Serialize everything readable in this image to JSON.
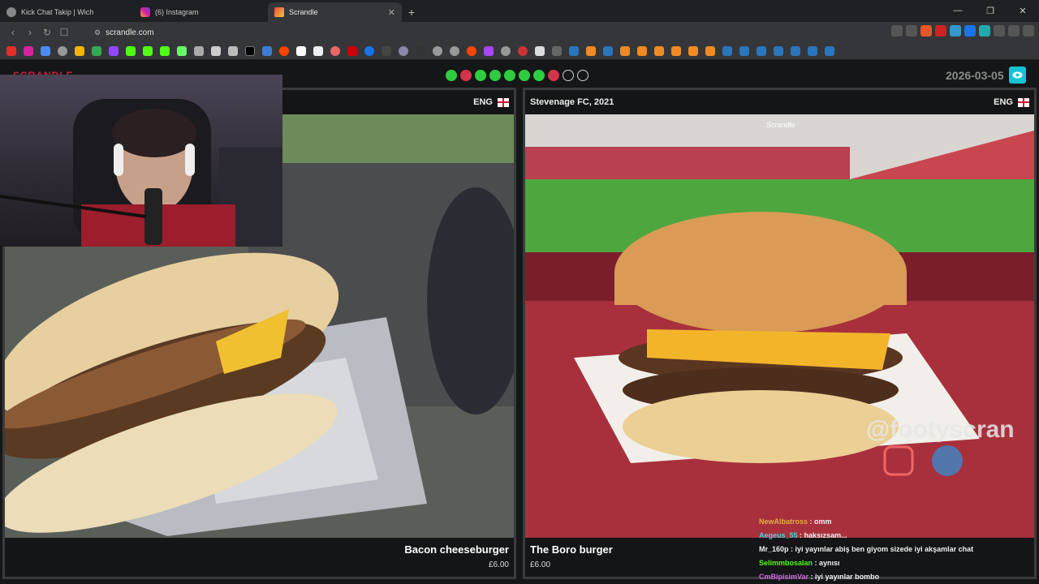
{
  "tabs": [
    {
      "title": "Kick Chat Takip | Wich",
      "icon": "globe-icon",
      "active": false
    },
    {
      "title": "(6) Instagram",
      "icon": "instagram-icon",
      "active": false
    },
    {
      "title": "Scrandle",
      "icon": "scrandle-icon",
      "active": true
    }
  ],
  "address": {
    "url": "scrandle.com"
  },
  "page": {
    "logo": "SCRANDLE",
    "date": "2026-03-05",
    "results": [
      "win",
      "lose",
      "win",
      "win",
      "win",
      "win",
      "win",
      "lose",
      "empty",
      "empty"
    ]
  },
  "cards": [
    {
      "club": "",
      "country": "ENG",
      "food": "Bacon cheeseburger",
      "price": "£6.00"
    },
    {
      "club": "Stevenage FC, 2021",
      "country": "ENG",
      "food": "The Boro burger",
      "price": "£6.00",
      "watermark": "Scrandle",
      "credit": "@footyscran"
    }
  ],
  "chat": [
    {
      "user": "NewAlbatross",
      "msg": ": omm"
    },
    {
      "user": "Aegeus_55",
      "msg": ": haksızsam..."
    },
    {
      "user": "Mr_160p",
      "msg": ": iyi yayınlar abiş ben giyom sizede iyi akşamlar chat"
    },
    {
      "user": "Selimmbosalan",
      "msg": ": aynısı"
    },
    {
      "user": "CmBipisimVar",
      "msg": ": iyi yayınlar bombo"
    }
  ],
  "colors": {
    "win": "#2ecc40",
    "lose": "#d2344a",
    "accent": "#16c2d5"
  }
}
